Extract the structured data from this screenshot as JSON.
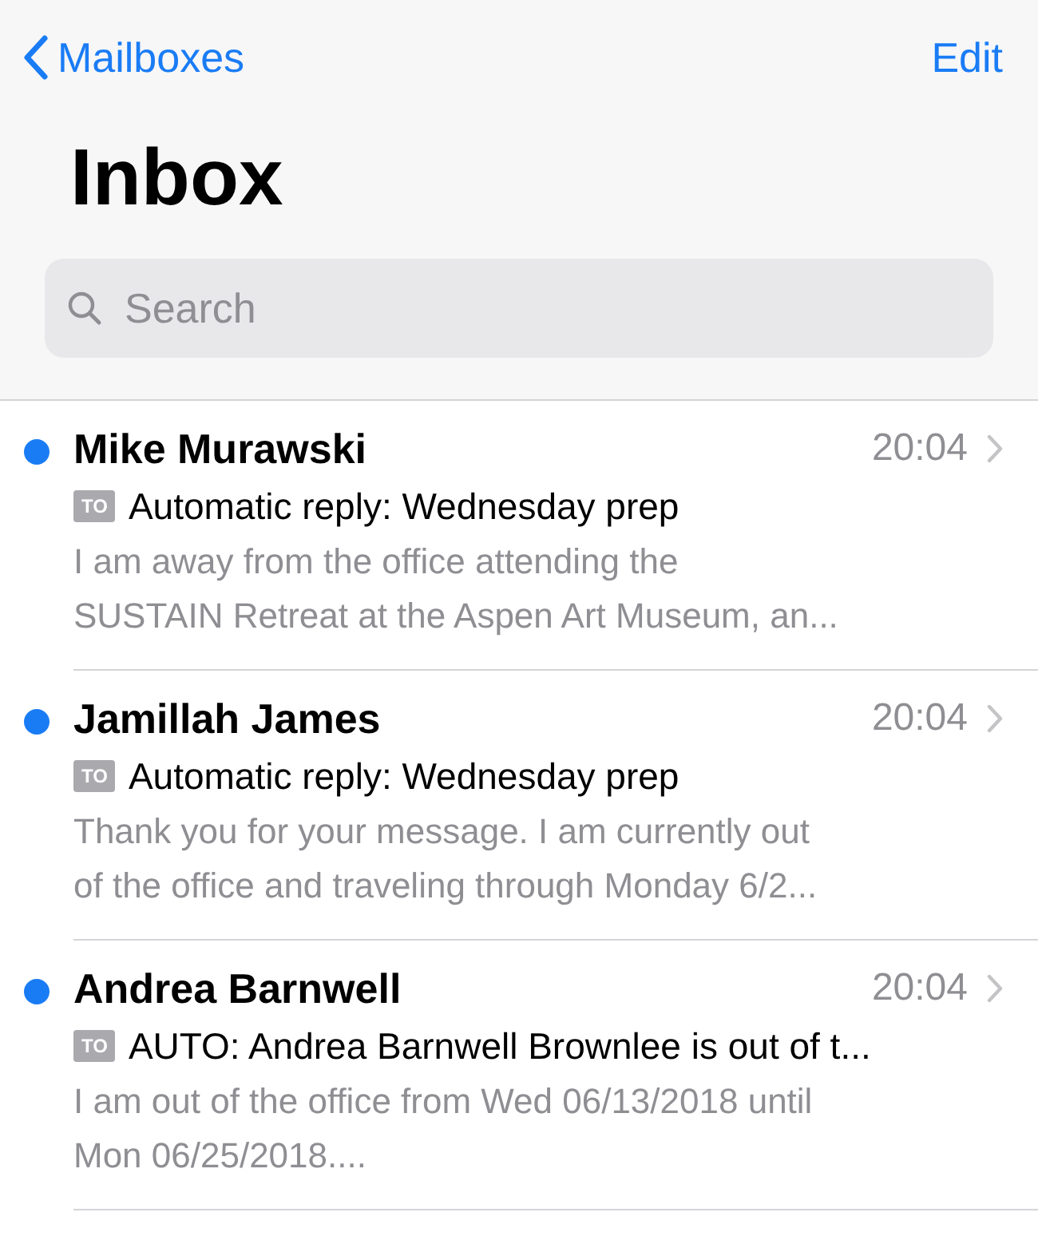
{
  "nav": {
    "back_label": "Mailboxes",
    "action": "Edit"
  },
  "title": "Inbox",
  "search": {
    "placeholder": "Search"
  },
  "messages": [
    {
      "sender": "Mike Murawski",
      "time": "20:04",
      "unread": true,
      "badge": "TO",
      "subject": "Automatic reply: Wednesday prep",
      "preview_lines": [
        "I am away from the office attending the",
        "SUSTAIN Retreat at the Aspen Art Museum, an..."
      ]
    },
    {
      "sender": "Jamillah James",
      "time": "20:04",
      "unread": true,
      "badge": "TO",
      "subject": "Automatic reply: Wednesday prep",
      "preview_lines": [
        "Thank you for your message. I am currently out",
        "of the office and traveling through Monday 6/2..."
      ]
    },
    {
      "sender": "Andrea Barnwell",
      "time": "20:04",
      "unread": true,
      "badge": "TO",
      "subject": "AUTO: Andrea Barnwell Brownlee is out of t...",
      "preview_lines": [
        "I am out of the office from Wed 06/13/2018 until",
        "Mon 06/25/2018...."
      ]
    }
  ]
}
